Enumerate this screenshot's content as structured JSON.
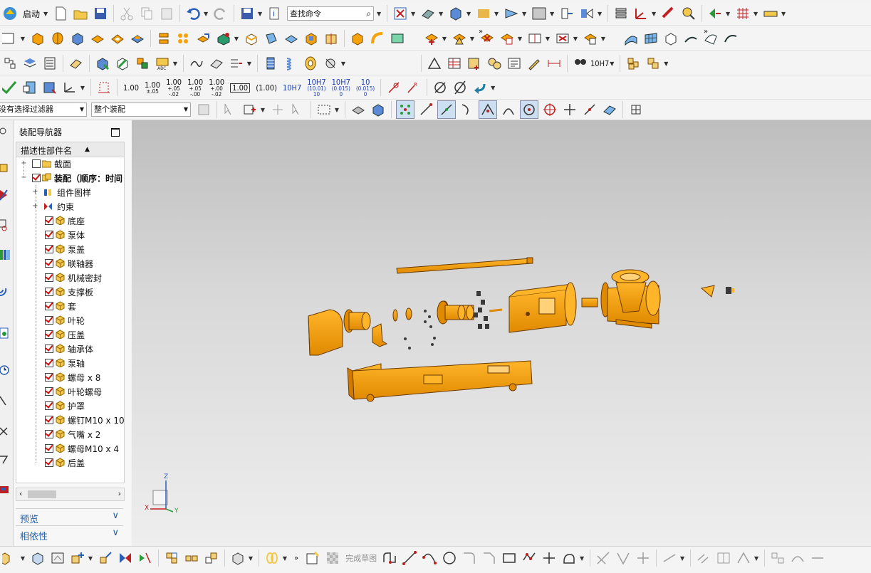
{
  "toolbar": {
    "start_label": "启动",
    "search_placeholder": "查找命令",
    "dims": {
      "d1": "1.00",
      "d2_main": "1.00",
      "d2_sub": "±.05",
      "d3_main": "1.00",
      "d3_sub": "+.05\n-.02",
      "d4_main": "1.00",
      "d4_sub": "+.05\n-.00",
      "d5_main": "1.00",
      "d5_sub": "+.00\n-.02",
      "d6": "1.00",
      "d7": "(1.00)",
      "d8": "10H7",
      "d9_main": "10H7",
      "d9_sub": "(10.01)\n10",
      "d10_main": "10H7",
      "d10_sub": "(0.015)\n0",
      "d11_main": "10",
      "d11_sub": "(0.015)\n0",
      "fit_label": "10H7"
    }
  },
  "filter": {
    "selection_filter": "没有选择过滤器",
    "scope": "整个装配"
  },
  "navigator": {
    "title": "装配导航器",
    "column_header": "描述性部件名",
    "root_items": [
      {
        "label": "截面",
        "checked": false
      },
      {
        "label": "装配（顺序：时间",
        "checked": true
      }
    ],
    "sub_nodes": [
      {
        "label": "组件图样"
      },
      {
        "label": "约束"
      }
    ],
    "parts": [
      "底座",
      "泵体",
      "泵盖",
      "联轴器",
      "机械密封",
      "支撑板",
      "套",
      "叶轮",
      "压盖",
      "轴承体",
      "泵轴",
      "螺母 x 8",
      "叶轮螺母",
      "护罩",
      "螺钉M10 x 10",
      "气嘴 x 2",
      "螺母M10 x 4",
      "后盖"
    ],
    "panels": [
      {
        "label": "预览"
      },
      {
        "label": "相依性"
      }
    ]
  },
  "viewport": {
    "triad": {
      "x": "X",
      "y": "Y",
      "z": "Z"
    },
    "colors": {
      "part": "#f5a20c",
      "edge": "#6a3a00",
      "bg_top": "#bebebe",
      "bg_bottom": "#eeeeee"
    }
  },
  "bottombar": {
    "finish_sketch": "完成草图"
  },
  "colors": {
    "accent": "#1f5fa8",
    "check": "#d01010"
  }
}
